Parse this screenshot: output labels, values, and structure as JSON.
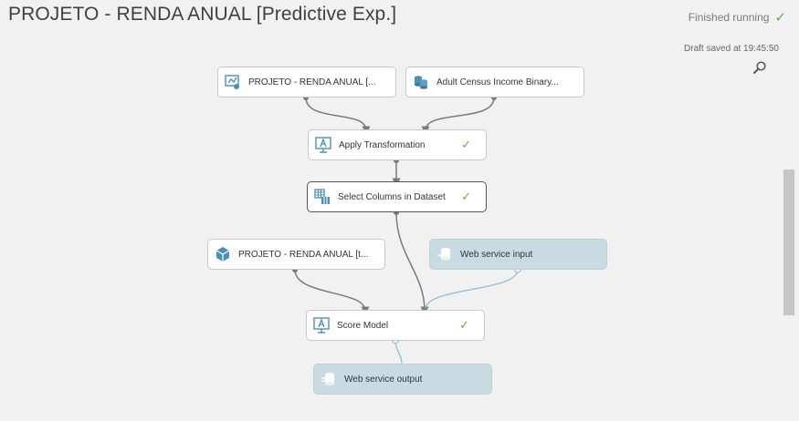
{
  "header": {
    "title": "PROJETO - RENDA ANUAL [Predictive Exp.]",
    "run_status": "Finished running",
    "draft_saved": "Draft saved at 19:45:50"
  },
  "icons": {
    "status": "check-icon",
    "search": "search-icon"
  },
  "colors": {
    "success": "#6aab2e",
    "web_service_fill": "#c8dbe3",
    "connector": "#7a7a7a",
    "web_service_connector": "#8ec0da"
  },
  "modules": {
    "trained_transform": {
      "label": "PROJETO - RENDA ANUAL [...",
      "icon": "transform-icon",
      "status": ""
    },
    "census_dataset": {
      "label": "Adult Census Income Binary...",
      "icon": "dataset-icon",
      "status": ""
    },
    "apply_transformation": {
      "label": "Apply Transformation",
      "icon": "module-icon",
      "status": "✓"
    },
    "select_columns": {
      "label": "Select Columns in Dataset",
      "icon": "select-columns-icon",
      "status": "✓"
    },
    "trained_model": {
      "label": "PROJETO - RENDA ANUAL [t...",
      "icon": "trained-model-icon",
      "status": ""
    },
    "web_service_input": {
      "label": "Web service input",
      "icon": "web-service-input-icon",
      "status": ""
    },
    "score_model": {
      "label": "Score Model",
      "icon": "module-icon",
      "status": "✓"
    },
    "web_service_output": {
      "label": "Web service output",
      "icon": "web-service-output-icon",
      "status": ""
    }
  }
}
